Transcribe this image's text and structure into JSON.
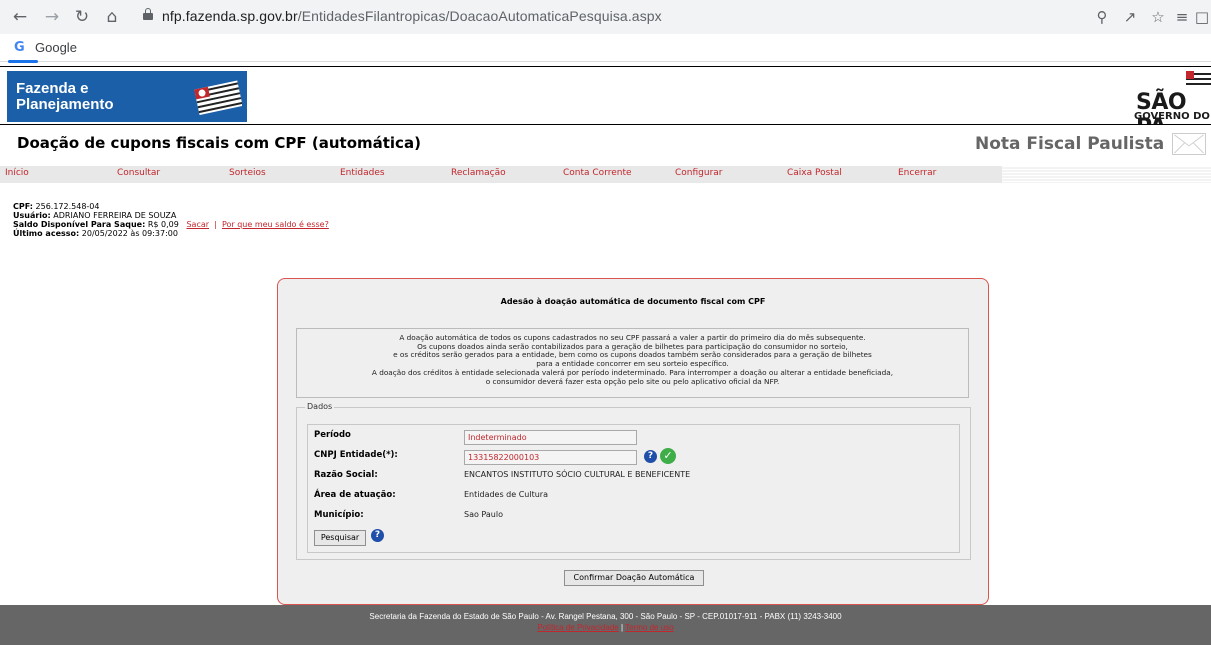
{
  "browser": {
    "url_domain": "nfp.fazenda.sp.gov.br",
    "url_path": "/EntidadesFilantropicas/DoacaoAutomaticaPesquisa.aspx",
    "bookmark_label": "Google",
    "icons": [
      "back-icon",
      "forward-icon",
      "reload-icon",
      "home-icon",
      "lock-icon",
      "zoom-icon",
      "share-icon",
      "star-icon",
      "reading-list-icon",
      "side-panel-icon"
    ]
  },
  "header": {
    "logo_line1": "Fazenda e",
    "logo_line2": "Planejamento",
    "sp_title": "SÃO PA",
    "sp_subtitle": "GOVERNO DO",
    "page_title": "Doação de cupons fiscais com CPF (automática)",
    "app_title": "Nota Fiscal Paulista",
    "colors": {
      "brand_blue": "#1b5fa8",
      "menu_red": "#c1272d"
    }
  },
  "menu": {
    "items": [
      "Início",
      "Consultar",
      "Sorteios",
      "Entidades",
      "Reclamação",
      "Conta Corrente",
      "Configurar",
      "Caixa Postal",
      "Encerrar"
    ]
  },
  "user": {
    "cpf_label": "CPF:",
    "cpf": "256.172.548-04",
    "usuario_label": "Usuário:",
    "usuario": "ADRIANO FERREIRA DE SOUZA",
    "saldo_label": "Saldo Disponível Para Saque:",
    "saldo": "R$ 0,09",
    "sacar": "Sacar",
    "separator": "|",
    "por_que": "Por que meu saldo é esse?",
    "ultimo_label": "Último acesso:",
    "ultimo": "20/05/2022 às 09:37:00"
  },
  "panel": {
    "title": "Adesão à doação automática de documento fiscal com CPF",
    "info_lines": [
      "A doação automática de todos os cupons cadastrados no seu CPF passará a valer a partir do primeiro dia do mês subsequente.",
      "Os cupons doados ainda serão contabilizados para a geração de bilhetes para participação do consumidor no sorteio,",
      "e os créditos serão gerados para a entidade, bem como os cupons doados também serão considerados para a geração de bilhetes",
      "para a entidade concorrer em seu sorteio específico.",
      "A doação dos créditos à entidade selecionada valerá por período indeterminado. Para interromper a doação ou alterar a entidade beneficiada,",
      "o consumidor deverá fazer esta opção pelo site ou pelo aplicativo oficial da NFP."
    ],
    "dados_legend": "Dados",
    "periodo_label": "Período",
    "periodo_value": "Indeterminado",
    "cnpj_label": "CNPJ Entidade(*):",
    "cnpj_value": "13315822000103",
    "razao_label": "Razão Social:",
    "razao_value": "ENCANTOS INSTITUTO SÓCIO CULTURAL E BENEFICENTE",
    "area_label": "Área de atuação:",
    "area_value": "Entidades de Cultura",
    "municipio_label": "Município:",
    "municipio_value": "Sao Paulo",
    "pesquisar_label": "Pesquisar",
    "confirmar_label": "Confirmar Doação Automática"
  },
  "footer": {
    "text": "Secretaria da Fazenda do Estado de São Paulo - Av. Rangel Pestana, 300 - São Paulo - SP - CEP.01017-911 - PABX (11) 3243-3400",
    "link1": "Política de Privacidade",
    "separator": "|",
    "link2": "Termo de uso"
  }
}
